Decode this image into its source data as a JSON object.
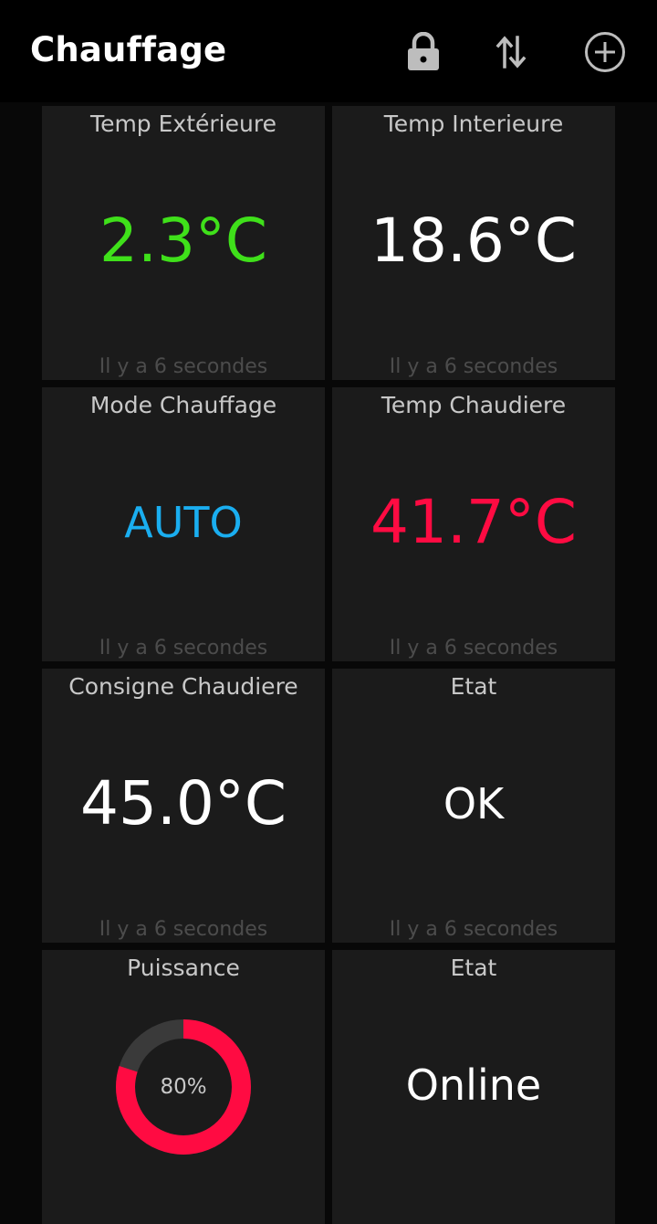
{
  "header": {
    "title": "Chauffage",
    "icons": [
      "lock-icon",
      "sort-arrows-icon",
      "add-circle-icon"
    ]
  },
  "colors": {
    "green": "#3fe01a",
    "white": "#ffffff",
    "blue": "#1aaef0",
    "red": "#ff0b42",
    "gauge_track": "#3a3a3a"
  },
  "tiles": [
    {
      "label": "Temp Extérieure",
      "value": "2.3°C",
      "time": "Il y a 6 secondes",
      "color": "#3fe01a"
    },
    {
      "label": "Temp Interieure",
      "value": "18.6°C",
      "time": "Il y a 6 secondes",
      "color": "#ffffff"
    },
    {
      "label": "Mode Chauffage",
      "value": "AUTO",
      "time": "Il y a 6 secondes",
      "color": "#1aaef0"
    },
    {
      "label": "Temp Chaudiere",
      "value": "41.7°C",
      "time": "Il y a 6 secondes",
      "color": "#ff0b42"
    },
    {
      "label": "Consigne Chaudiere",
      "value": "45.0°C",
      "time": "Il y a 6 secondes",
      "color": "#ffffff"
    },
    {
      "label": "Etat",
      "value": "OK",
      "time": "Il y a 6 secondes",
      "color": "#ffffff"
    },
    {
      "label": "Puissance",
      "gauge_text": "80%",
      "gauge_fraction": 0.8,
      "color": "#ff0b42"
    },
    {
      "label": "Etat",
      "value": "Online",
      "color": "#ffffff"
    }
  ]
}
